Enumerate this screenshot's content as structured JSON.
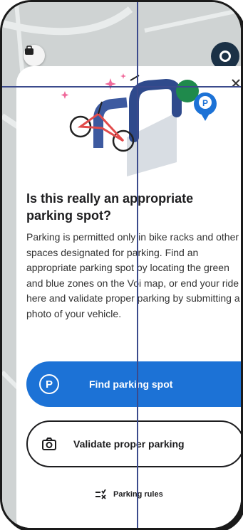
{
  "dialog": {
    "title": "Is this really an appropriate parking spot?",
    "body": "Parking is permitted only in bike racks and other spaces designated for parking. Find an appropriate parking spot by locating the green and blue zones on the Voi map, or end your ride here and validate proper parking by submitting a photo of your vehicle."
  },
  "buttons": {
    "find_parking": {
      "label": "Find parking spot",
      "icon": "parking-p-icon"
    },
    "validate_parking": {
      "label": "Validate proper parking",
      "icon": "camera-icon"
    },
    "parking_rules": {
      "label": "Parking rules",
      "icon": "rules-list-icon"
    }
  },
  "colors": {
    "primary_blue": "#1c72d6",
    "green_zone": "#1f8a4c",
    "blue_zone": "#1c72d6",
    "dark_text": "#1d1d1f"
  }
}
